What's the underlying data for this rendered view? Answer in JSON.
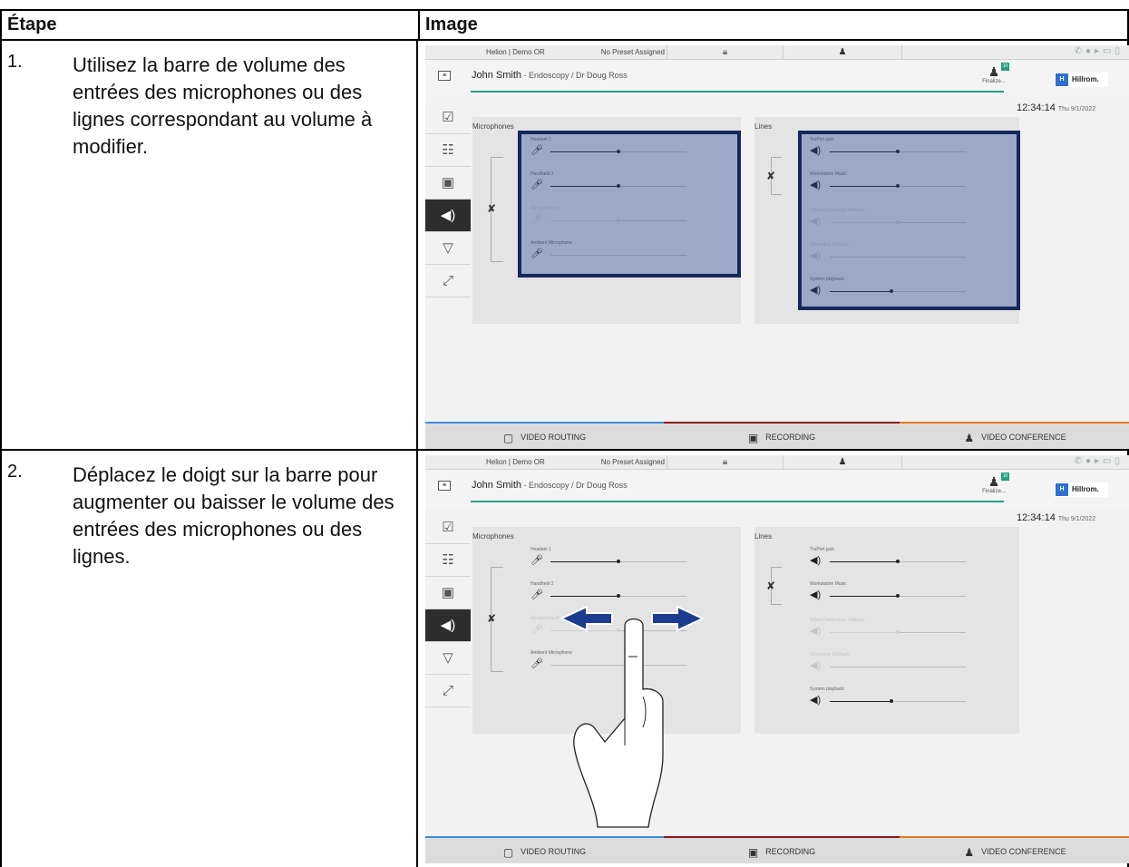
{
  "table": {
    "header_step": "Étape",
    "header_image": "Image"
  },
  "steps": [
    {
      "number": "1.",
      "text": "Utilisez la barre de volume des entrées des microphones ou des lignes correspondant au volume à modifier."
    },
    {
      "number": "2.",
      "text": "Déplacez le doigt sur la barre pour augmenter ou baisser le volume des entrées des microphones ou des lignes."
    }
  ],
  "ui": {
    "site": "Helion | Demo OR",
    "preset": "No Preset Assigned",
    "patient_name": "John Smith",
    "procedure": " - Endoscopy / Dr Doug Ross",
    "finalize": "Finalize...",
    "finalize_badge": "10",
    "logo": "Hillrom.",
    "logo_mark": "H",
    "time": "12:34:14",
    "date": "Thu 9/1/2022",
    "microphones_title": "Microphones",
    "lines_title": "Lines",
    "microphones": [
      {
        "name": "Headset 1",
        "level": 0.5,
        "enabled": true
      },
      {
        "name": "Handheld 2",
        "level": 0.5,
        "enabled": true
      },
      {
        "name": "Microphone #3",
        "level": 0.5,
        "enabled": false
      },
      {
        "name": "Ambient Microphone",
        "level": 0.0,
        "enabled": true
      }
    ],
    "lines": [
      {
        "name": "TruPort jack",
        "level": 0.5,
        "enabled": true
      },
      {
        "name": "Workstation Music",
        "level": 0.5,
        "enabled": true
      },
      {
        "name": "Video Conference Talkback",
        "level": 0.5,
        "enabled": false
      },
      {
        "name": "Streaming Talkback",
        "level": 0.0,
        "enabled": false
      },
      {
        "name": "System playback",
        "level": 0.45,
        "enabled": true
      }
    ],
    "footer": {
      "video_routing": "VIDEO ROUTING",
      "recording": "RECORDING",
      "video_conference": "VIDEO CONFERENCE"
    },
    "colors": {
      "accent_teal": "#2aa18b",
      "highlight": "#16275e",
      "video_routing": "#3b8ed8",
      "recording": "#8a1a1a",
      "video_conference": "#e07a23"
    }
  }
}
